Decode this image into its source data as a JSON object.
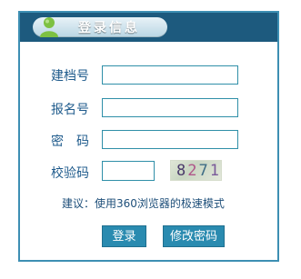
{
  "header": {
    "title": "登录信息"
  },
  "form": {
    "file_no": {
      "label": "建档号",
      "value": ""
    },
    "signup_no": {
      "label": "报名号",
      "value": ""
    },
    "password": {
      "label": "密　码",
      "value": ""
    },
    "captcha": {
      "label": "校验码",
      "value": "",
      "image_text": "8271"
    }
  },
  "hint": "建议：使用360浏览器的极速模式",
  "buttons": {
    "login": "登录",
    "change_password": "修改密码"
  },
  "colors": {
    "header_bg": "#1d5a7e",
    "border": "#3d8fb3",
    "button_bg": "#2a8bb0",
    "label": "#1f5b8c"
  }
}
